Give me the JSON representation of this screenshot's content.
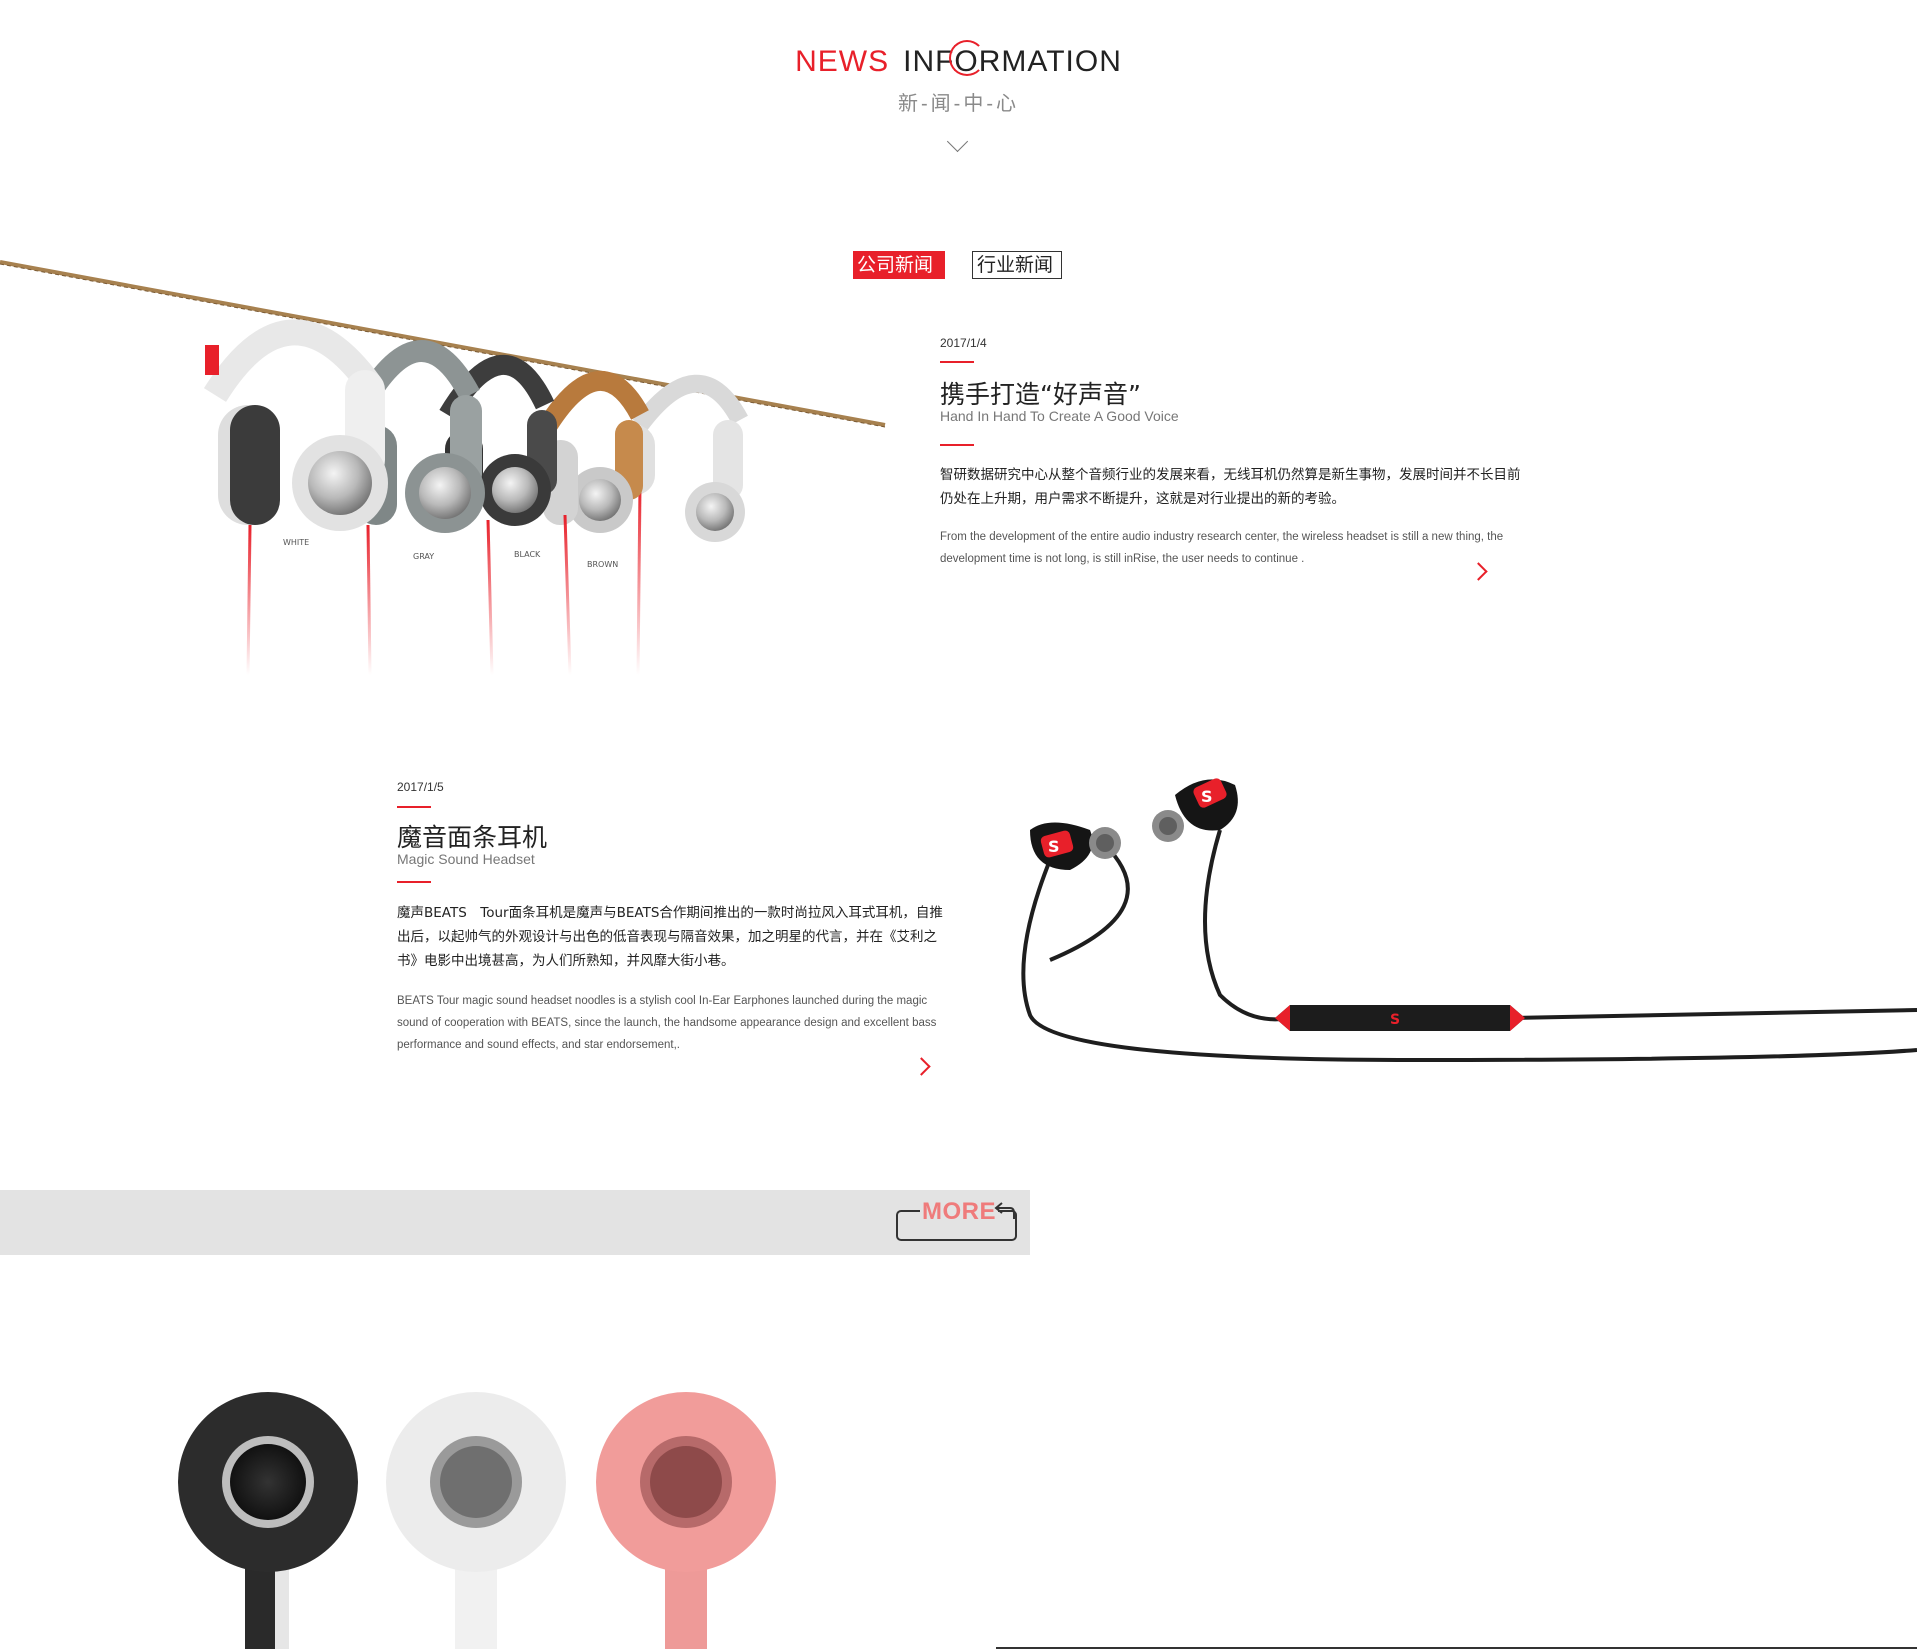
{
  "header": {
    "title_left": "NEWS",
    "title_right": "INFORMATION",
    "subtitle": "新-闻-中-心"
  },
  "tabs": {
    "company_news": "公司新闻",
    "industry_news": "行业新闻"
  },
  "articles": [
    {
      "date": "2017/1/4",
      "title": "携手打造“好声音”",
      "title_en": "Hand In Hand To Create A Good Voice",
      "body_cn": "智研数据研究中心从整个音频行业的发展来看，无线耳机仍然算是新生事物，发展时间并不长目前仍处在上升期，用户需求不断提升，这就是对行业提出的新的考验。",
      "body_en": "From the development of the entire audio industry research center, the wireless headset is still a new thing, the development time is not long, is still inRise, the user needs to continue ."
    },
    {
      "date": "2017/1/5",
      "title": "魔音面条耳机",
      "title_en": "Magic Sound Headset",
      "body_cn": "魔声BEATS　Tour面条耳机是魔声与BEATS合作期间推出的一款时尚拉风入耳式耳机，自推出后，以起帅气的外观设计与出色的低音表现与隔音效果，加之明星的代言，并在《艾利之书》电影中出境甚高，为人们所熟知，并风靡大街小巷。",
      "body_en": "BEATS Tour magic sound headset noodles is a stylish cool In-Ear Earphones launched during the magic sound of cooperation with BEATS, since the launch, the handsome appearance design and excellent bass performance and sound effects, and star endorsement,."
    }
  ],
  "headphone_labels": [
    "WHITE",
    "GRAY",
    "BLACK",
    "BROWN"
  ],
  "more": {
    "label": "MORE"
  },
  "colors": {
    "accent": "#e8202a",
    "more_text": "#ef7b7b",
    "more_bar": "#e3e3e3"
  }
}
